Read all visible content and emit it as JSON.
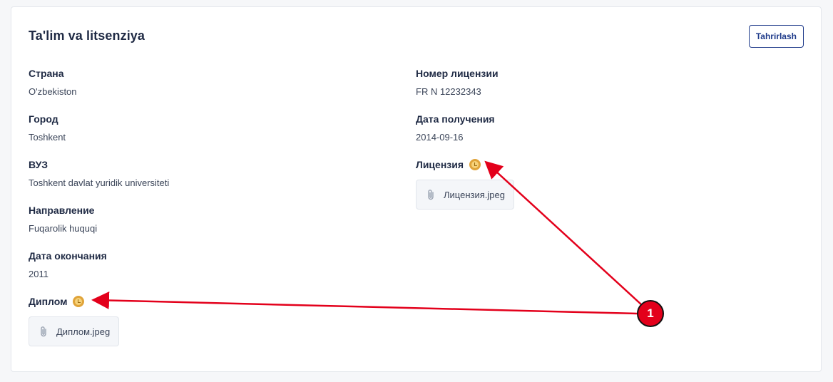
{
  "card": {
    "title": "Ta'lim va litsenziya",
    "edit_label": "Tahrirlash"
  },
  "left_fields": [
    {
      "label": "Страна",
      "value": "O'zbekiston"
    },
    {
      "label": "Город",
      "value": "Toshkent"
    },
    {
      "label": "ВУЗ",
      "value": "Toshkent davlat yuridik universiteti"
    },
    {
      "label": "Направление",
      "value": "Fuqarolik huquqi"
    },
    {
      "label": "Дата окончания",
      "value": "2011"
    }
  ],
  "diploma": {
    "label": "Диплом",
    "file": "Диплом.jpeg",
    "status_icon": "pending-clock-icon"
  },
  "right_fields": [
    {
      "label": "Номер лицензии",
      "value": "FR N 12232343"
    },
    {
      "label": "Дата получения",
      "value": "2014-09-16"
    }
  ],
  "license": {
    "label": "Лицензия",
    "file": "Лицензия.jpeg",
    "status_icon": "pending-clock-icon"
  },
  "annotation": {
    "marker_label": "1",
    "color": "#e3001b"
  },
  "colors": {
    "pending": "#e0a43a",
    "accent": "#1e3a8a",
    "text": "#1f2a44"
  }
}
